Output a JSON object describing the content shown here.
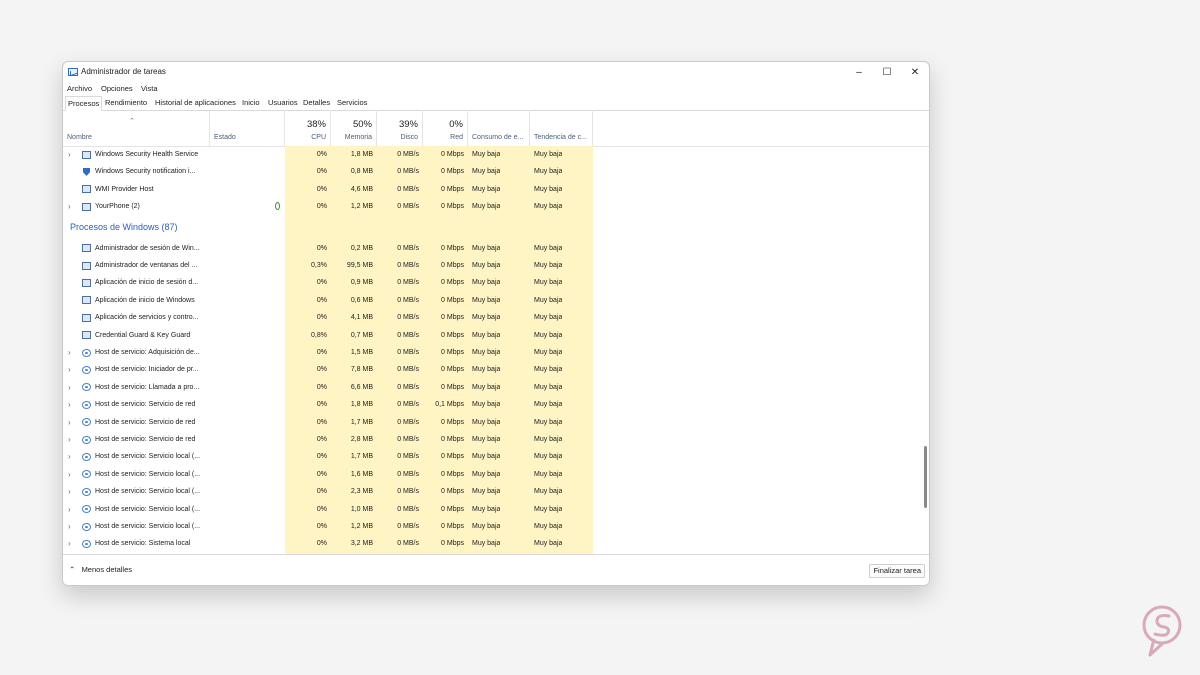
{
  "window": {
    "title": "Administrador de tareas"
  },
  "menu": [
    "Archivo",
    "Opciones",
    "Vista"
  ],
  "tabs": [
    "Procesos",
    "Rendimiento",
    "Historial de aplicaciones",
    "Inicio",
    "Usuarios",
    "Detalles",
    "Servicios"
  ],
  "active_tab": "Procesos",
  "columns": {
    "name": "Nombre",
    "status": "Estado",
    "cpu": {
      "pct": "38%",
      "label": "CPU"
    },
    "memory": {
      "pct": "50%",
      "label": "Memoria"
    },
    "disk": {
      "pct": "39%",
      "label": "Disco"
    },
    "network": {
      "pct": "0%",
      "label": "Red"
    },
    "power": "Consumo de e...",
    "power_trend": "Tendencia de c..."
  },
  "rows_top": [
    {
      "expand": "›",
      "icon": "window-app-icon",
      "name": "Windows Security Health Service",
      "cpu": "0%",
      "mem": "1,8 MB",
      "disk": "0 MB/s",
      "net": "0 Mbps",
      "power": "Muy baja",
      "trend": "Muy baja"
    },
    {
      "expand": "",
      "icon": "shield-icon",
      "name": "Windows Security notification i...",
      "cpu": "0%",
      "mem": "0,8 MB",
      "disk": "0 MB/s",
      "net": "0 Mbps",
      "power": "Muy baja",
      "trend": "Muy baja"
    },
    {
      "expand": "",
      "icon": "window-app-icon",
      "name": "WMI Provider Host",
      "cpu": "0%",
      "mem": "4,6 MB",
      "disk": "0 MB/s",
      "net": "0 Mbps",
      "power": "Muy baja",
      "trend": "Muy baja"
    },
    {
      "expand": "›",
      "icon": "window-app-icon",
      "name": "YourPhone (2)",
      "cpu": "0%",
      "mem": "1,2 MB",
      "disk": "0 MB/s",
      "net": "0 Mbps",
      "power": "Muy baja",
      "trend": "Muy baja",
      "status_icon": "leaf-icon"
    }
  ],
  "group_title": "Procesos de Windows (87)",
  "rows_windows": [
    {
      "expand": "",
      "icon": "window-app-icon",
      "name": "Administrador de sesión de Win...",
      "cpu": "0%",
      "mem": "0,2 MB",
      "disk": "0 MB/s",
      "net": "0 Mbps",
      "power": "Muy baja",
      "trend": "Muy baja"
    },
    {
      "expand": "",
      "icon": "window-app-icon",
      "name": "Administrador de ventanas del ...",
      "cpu": "0,3%",
      "mem": "99,5 MB",
      "disk": "0 MB/s",
      "net": "0 Mbps",
      "power": "Muy baja",
      "trend": "Muy baja"
    },
    {
      "expand": "",
      "icon": "window-app-icon",
      "name": "Aplicación de inicio de sesión d...",
      "cpu": "0%",
      "mem": "0,9 MB",
      "disk": "0 MB/s",
      "net": "0 Mbps",
      "power": "Muy baja",
      "trend": "Muy baja"
    },
    {
      "expand": "",
      "icon": "window-app-icon",
      "name": "Aplicación de inicio de Windows",
      "cpu": "0%",
      "mem": "0,6 MB",
      "disk": "0 MB/s",
      "net": "0 Mbps",
      "power": "Muy baja",
      "trend": "Muy baja"
    },
    {
      "expand": "",
      "icon": "window-app-icon",
      "name": "Aplicación de servicios y contro...",
      "cpu": "0%",
      "mem": "4,1 MB",
      "disk": "0 MB/s",
      "net": "0 Mbps",
      "power": "Muy baja",
      "trend": "Muy baja"
    },
    {
      "expand": "",
      "icon": "window-app-icon",
      "name": "Credential Guard & Key Guard",
      "cpu": "0,8%",
      "mem": "0,7 MB",
      "disk": "0 MB/s",
      "net": "0 Mbps",
      "power": "Muy baja",
      "trend": "Muy baja"
    },
    {
      "expand": "›",
      "icon": "gear-icon",
      "name": "Host de servicio: Adquisición de...",
      "cpu": "0%",
      "mem": "1,5 MB",
      "disk": "0 MB/s",
      "net": "0 Mbps",
      "power": "Muy baja",
      "trend": "Muy baja"
    },
    {
      "expand": "›",
      "icon": "gear-icon",
      "name": "Host de servicio: Iniciador de pr...",
      "cpu": "0%",
      "mem": "7,8 MB",
      "disk": "0 MB/s",
      "net": "0 Mbps",
      "power": "Muy baja",
      "trend": "Muy baja"
    },
    {
      "expand": "›",
      "icon": "gear-icon",
      "name": "Host de servicio: Llamada a pro...",
      "cpu": "0%",
      "mem": "6,6 MB",
      "disk": "0 MB/s",
      "net": "0 Mbps",
      "power": "Muy baja",
      "trend": "Muy baja"
    },
    {
      "expand": "›",
      "icon": "gear-icon",
      "name": "Host de servicio: Servicio de red",
      "cpu": "0%",
      "mem": "1,8 MB",
      "disk": "0 MB/s",
      "net": "0,1 Mbps",
      "power": "Muy baja",
      "trend": "Muy baja"
    },
    {
      "expand": "›",
      "icon": "gear-icon",
      "name": "Host de servicio: Servicio de red",
      "cpu": "0%",
      "mem": "1,7 MB",
      "disk": "0 MB/s",
      "net": "0 Mbps",
      "power": "Muy baja",
      "trend": "Muy baja"
    },
    {
      "expand": "›",
      "icon": "gear-icon",
      "name": "Host de servicio: Servicio de red",
      "cpu": "0%",
      "mem": "2,8 MB",
      "disk": "0 MB/s",
      "net": "0 Mbps",
      "power": "Muy baja",
      "trend": "Muy baja"
    },
    {
      "expand": "›",
      "icon": "gear-icon",
      "name": "Host de servicio: Servicio local (...",
      "cpu": "0%",
      "mem": "1,7 MB",
      "disk": "0 MB/s",
      "net": "0 Mbps",
      "power": "Muy baja",
      "trend": "Muy baja"
    },
    {
      "expand": "›",
      "icon": "gear-icon",
      "name": "Host de servicio: Servicio local (...",
      "cpu": "0%",
      "mem": "1,6 MB",
      "disk": "0 MB/s",
      "net": "0 Mbps",
      "power": "Muy baja",
      "trend": "Muy baja"
    },
    {
      "expand": "›",
      "icon": "gear-icon",
      "name": "Host de servicio: Servicio local (...",
      "cpu": "0%",
      "mem": "2,3 MB",
      "disk": "0 MB/s",
      "net": "0 Mbps",
      "power": "Muy baja",
      "trend": "Muy baja"
    },
    {
      "expand": "›",
      "icon": "gear-icon",
      "name": "Host de servicio: Servicio local (...",
      "cpu": "0%",
      "mem": "1,0 MB",
      "disk": "0 MB/s",
      "net": "0 Mbps",
      "power": "Muy baja",
      "trend": "Muy baja"
    },
    {
      "expand": "›",
      "icon": "gear-icon",
      "name": "Host de servicio: Servicio local (...",
      "cpu": "0%",
      "mem": "1,2 MB",
      "disk": "0 MB/s",
      "net": "0 Mbps",
      "power": "Muy baja",
      "trend": "Muy baja"
    },
    {
      "expand": "›",
      "icon": "gear-icon",
      "name": "Host de servicio: Sistema local",
      "cpu": "0%",
      "mem": "3,2 MB",
      "disk": "0 MB/s",
      "net": "0 Mbps",
      "power": "Muy baja",
      "trend": "Muy baja"
    }
  ],
  "footer": {
    "less_details": "Menos detalles",
    "end_task": "Finalizar tarea"
  },
  "colors": {
    "highlight": "#fff4c4",
    "highlight_strong": "#ffefb0",
    "group_title": "#2b5fb8",
    "logo": "#d8a9b6"
  }
}
